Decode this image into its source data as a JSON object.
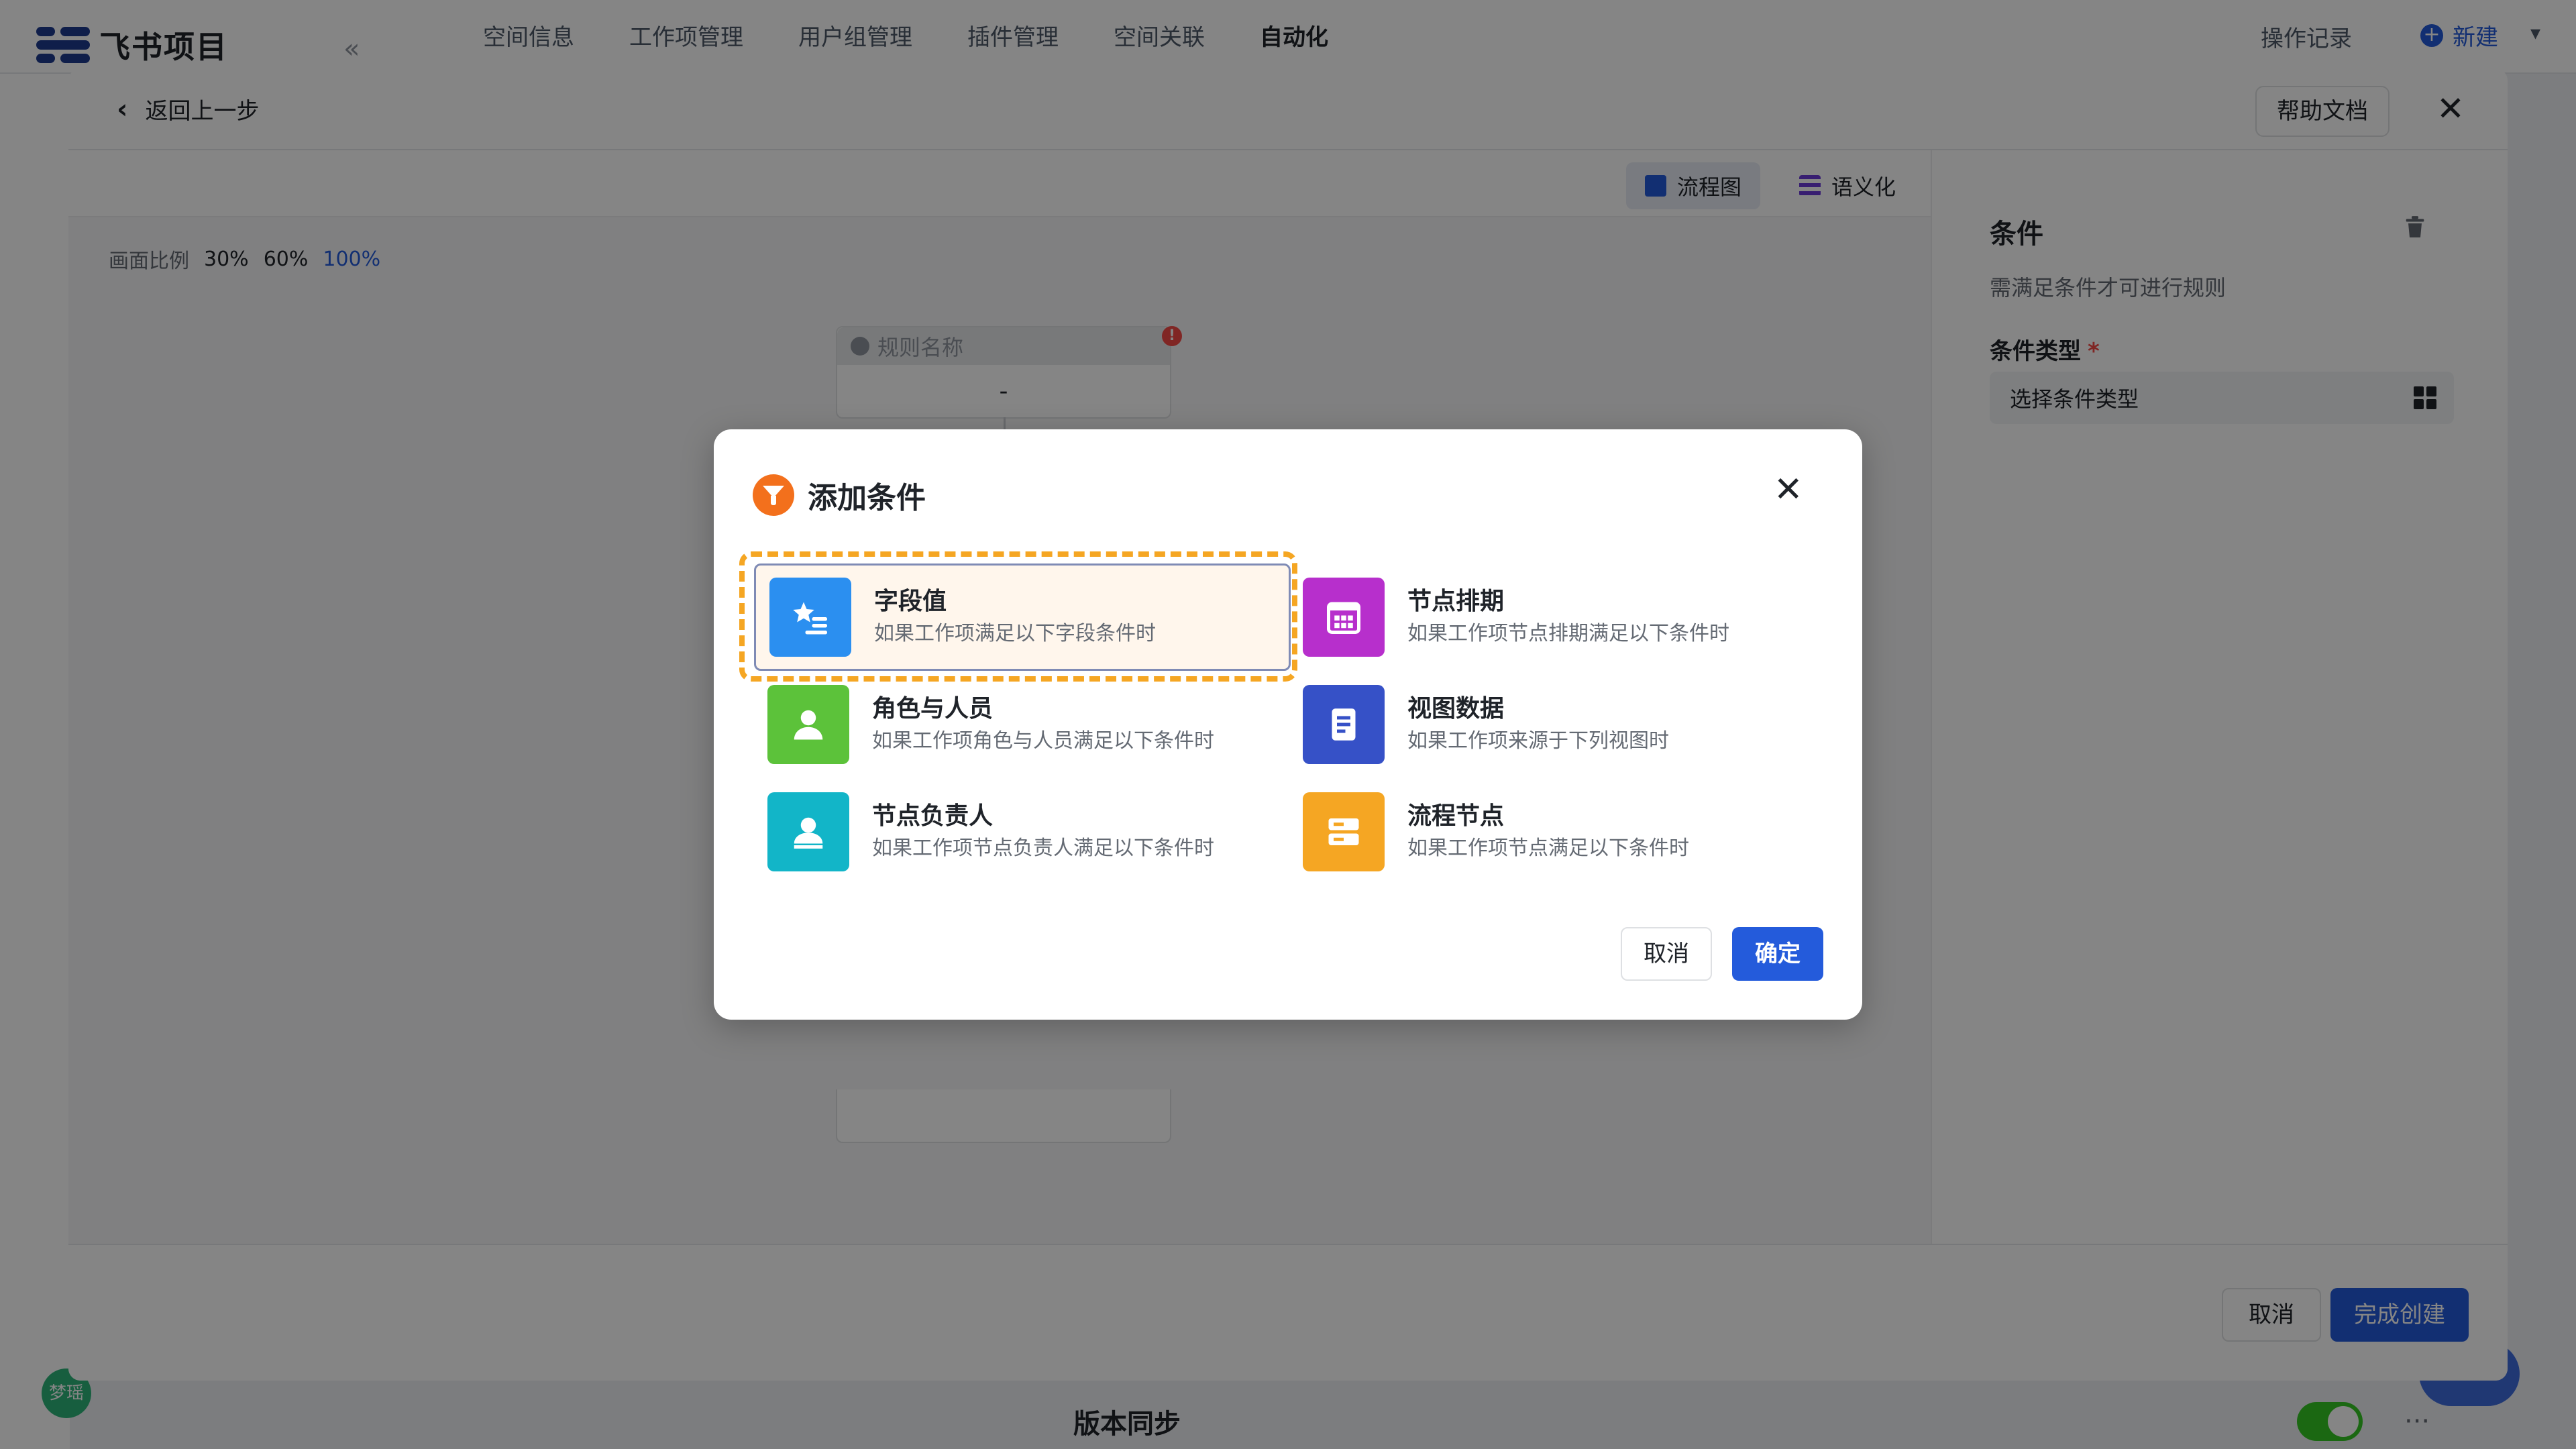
{
  "app": {
    "logo_text": "飞书项目",
    "nav": [
      "空间信息",
      "工作项管理",
      "用户组管理",
      "插件管理",
      "空间关联",
      "自动化"
    ],
    "active_nav": "自动化",
    "oplog": "操作记录",
    "new_label": "新建",
    "bottom_title": "版本同步",
    "avatar_text": "梦瑶"
  },
  "panel": {
    "back_label": "返回上一步",
    "help_doc": "帮助文档",
    "view_tabs": [
      {
        "label": "流程图",
        "active": true
      },
      {
        "label": "语义化",
        "active": false
      }
    ],
    "ratio_label": "画面比例",
    "ratio_options": [
      "30%",
      "60%",
      "100%"
    ],
    "ratio_selected": "100%",
    "node": {
      "title": "规则名称",
      "body": "-"
    },
    "footer": {
      "cancel": "取消",
      "done": "完成创建"
    }
  },
  "side": {
    "title": "条件",
    "desc": "需满足条件才可进行规则",
    "field_label": "条件类型",
    "required_mark": "*",
    "select_placeholder": "选择条件类型"
  },
  "modal": {
    "title": "添加条件",
    "options": [
      {
        "title": "字段值",
        "desc": "如果工作项满足以下字段条件时",
        "icon": "star-list-icon",
        "color": "#2b8ff0",
        "selected": true
      },
      {
        "title": "节点排期",
        "desc": "如果工作项节点排期满足以下条件时",
        "icon": "calendar-icon",
        "color": "#b72fcc",
        "selected": false
      },
      {
        "title": "角色与人员",
        "desc": "如果工作项角色与人员满足以下条件时",
        "icon": "person-icon",
        "color": "#5cc23a",
        "selected": false
      },
      {
        "title": "视图数据",
        "desc": "如果工作项来源于下列视图时",
        "icon": "document-icon",
        "color": "#3651c7",
        "selected": false
      },
      {
        "title": "节点负责人",
        "desc": "如果工作项节点负责人满足以下条件时",
        "icon": "person-badge-icon",
        "color": "#12b5c8",
        "selected": false
      },
      {
        "title": "流程节点",
        "desc": "如果工作项节点满足以下条件时",
        "icon": "server-node-icon",
        "color": "#f5a623",
        "selected": false
      }
    ],
    "cancel": "取消",
    "ok": "确定"
  },
  "colors": {
    "accent": "#245bdb",
    "highlight_dash": "#f5a623",
    "header_icon": "#f3701c"
  }
}
